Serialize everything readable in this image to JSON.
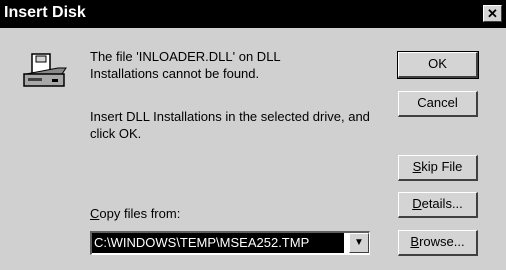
{
  "window": {
    "title": "Insert Disk",
    "close_glyph": "✕"
  },
  "message": {
    "line1": "The file 'INLOADER.DLL' on DLL Installations cannot be found.",
    "line2": "Insert DLL Installations in the selected drive, and click OK."
  },
  "buttons": {
    "ok": "OK",
    "cancel": "Cancel",
    "skip_file": {
      "underline": "S",
      "rest": "kip File"
    },
    "details": {
      "underline": "D",
      "rest": "etails..."
    },
    "browse": {
      "underline": "B",
      "rest": "rowse..."
    }
  },
  "copy_from": {
    "label_underline": "C",
    "label_rest": "opy files from:",
    "value": "C:\\WINDOWS\\TEMP\\MSEA252.TMP",
    "dropdown_glyph": "▼"
  },
  "icons": {
    "disk": "floppy-drive-icon"
  }
}
